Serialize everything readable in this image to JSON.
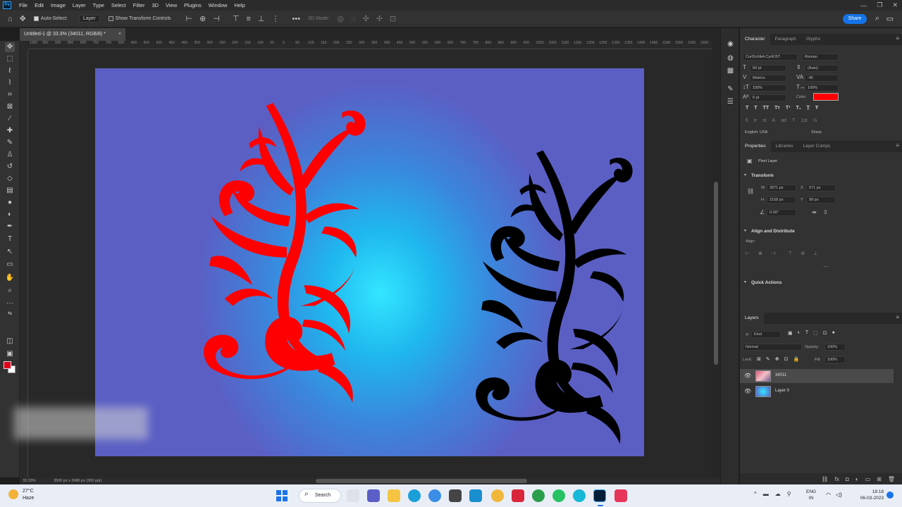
{
  "app": {
    "logo": "Ps"
  },
  "menu": [
    "File",
    "Edit",
    "Image",
    "Layer",
    "Type",
    "Select",
    "Filter",
    "3D",
    "View",
    "Plugins",
    "Window",
    "Help"
  ],
  "window_controls": [
    "—",
    "❐",
    "✕"
  ],
  "options_bar": {
    "auto_select_label": "Auto-Select:",
    "auto_select_target": "Layer",
    "show_transform_label": "Show Transform Controls",
    "mode_3d": "3D Mode:",
    "share_label": "Share"
  },
  "document": {
    "tab_title": "Untitled-1 @ 33.3% (34011, RGB/8) *",
    "close_glyph": "×",
    "status_zoom": "33.33%",
    "status_info": "3500 px x 2480 px (300 ppi)"
  },
  "ruler_ticks": [
    "1000",
    "950",
    "900",
    "850",
    "800",
    "750",
    "700",
    "650",
    "600",
    "550",
    "500",
    "450",
    "400",
    "350",
    "300",
    "250",
    "200",
    "150",
    "100",
    "50",
    "0",
    "50",
    "100",
    "150",
    "200",
    "250",
    "300",
    "350",
    "400",
    "450",
    "500",
    "550",
    "600",
    "650",
    "700",
    "750",
    "800",
    "850",
    "900",
    "950",
    "1000",
    "1050",
    "1100",
    "1150",
    "1200",
    "1250",
    "1300",
    "1350",
    "1400",
    "1450",
    "1500",
    "1550",
    "1600",
    "1650"
  ],
  "character_panel": {
    "tabs": [
      "Character",
      "Paragraph",
      "Glyphs"
    ],
    "font_family": "CurlSchlkA Cyrill BT",
    "font_style": "Roman",
    "font_size": "60 pt",
    "leading": "(Auto)",
    "kerning": "Metrics",
    "tracking": "-45",
    "vscale": "100%",
    "hscale": "100%",
    "baseline": "0 pt",
    "color_label": "Color:",
    "color": "#ff0000",
    "language": "English: USA",
    "antialias": "Sharp"
  },
  "properties_panel": {
    "tabs": [
      "Properties",
      "Libraries",
      "Layer Comps"
    ],
    "layer_type": "Pixel Layer",
    "transform_header": "Transform",
    "w_label": "W",
    "w_value": "2871 px",
    "x_label": "X",
    "x_value": "571 px",
    "h_label": "H",
    "h_value": "2158 px",
    "y_label": "Y",
    "y_value": "99 px",
    "angle": "0.00°",
    "align_header": "Align and Distribute",
    "align_label": "Align:",
    "quick_actions_header": "Quick Actions"
  },
  "layers_panel": {
    "tab": "Layers",
    "filter_kind": "Kind",
    "blend_mode": "Normal",
    "opacity_label": "Opacity:",
    "opacity": "100%",
    "lock_label": "Lock:",
    "fill_label": "Fill:",
    "fill": "100%",
    "layers": [
      {
        "name": "34011",
        "selected": true
      },
      {
        "name": "Layer 0",
        "selected": false
      }
    ]
  },
  "taskbar": {
    "weather_temp": "27°C",
    "weather_desc": "Haze",
    "search_label": "Search",
    "lang_top": "ENG",
    "lang_bottom": "IN",
    "time": "18:18",
    "date": "06-03-2023"
  },
  "colors": {
    "ornament_left": "#ff0000",
    "ornament_right": "#000000",
    "canvas_center": "#33e6ff",
    "canvas_edge": "#5b5fc4",
    "foreground": "#e0001b",
    "background": "#ffffff",
    "accent": "#1473e6"
  }
}
